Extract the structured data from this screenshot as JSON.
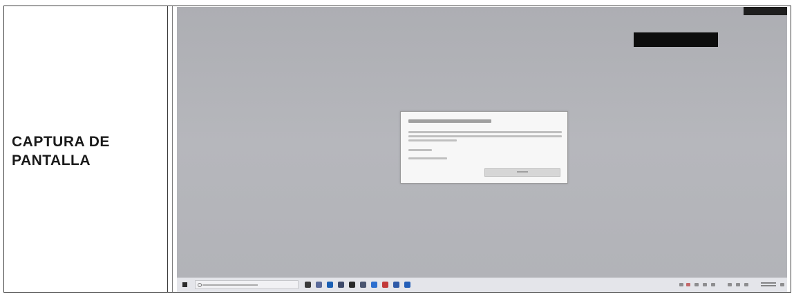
{
  "label": {
    "line1": "CAPTURA DE",
    "line2": "PANTALLA"
  },
  "taskbar": {
    "icons": [
      {
        "name": "task-view-icon",
        "color": "#3a3a3a"
      },
      {
        "name": "widgets-icon",
        "color": "#5a6a9a"
      },
      {
        "name": "edge-icon",
        "color": "#1a5fb4"
      },
      {
        "name": "file-explorer-icon",
        "color": "#3e4a6a"
      },
      {
        "name": "store-icon",
        "color": "#2a2a2a"
      },
      {
        "name": "mail-icon",
        "color": "#4a5570"
      },
      {
        "name": "outlook-icon",
        "color": "#2d6fcf"
      },
      {
        "name": "chrome-icon",
        "color": "#c23a3a"
      },
      {
        "name": "teams-icon",
        "color": "#2f5aa8"
      },
      {
        "name": "word-icon",
        "color": "#245fb8"
      }
    ]
  }
}
